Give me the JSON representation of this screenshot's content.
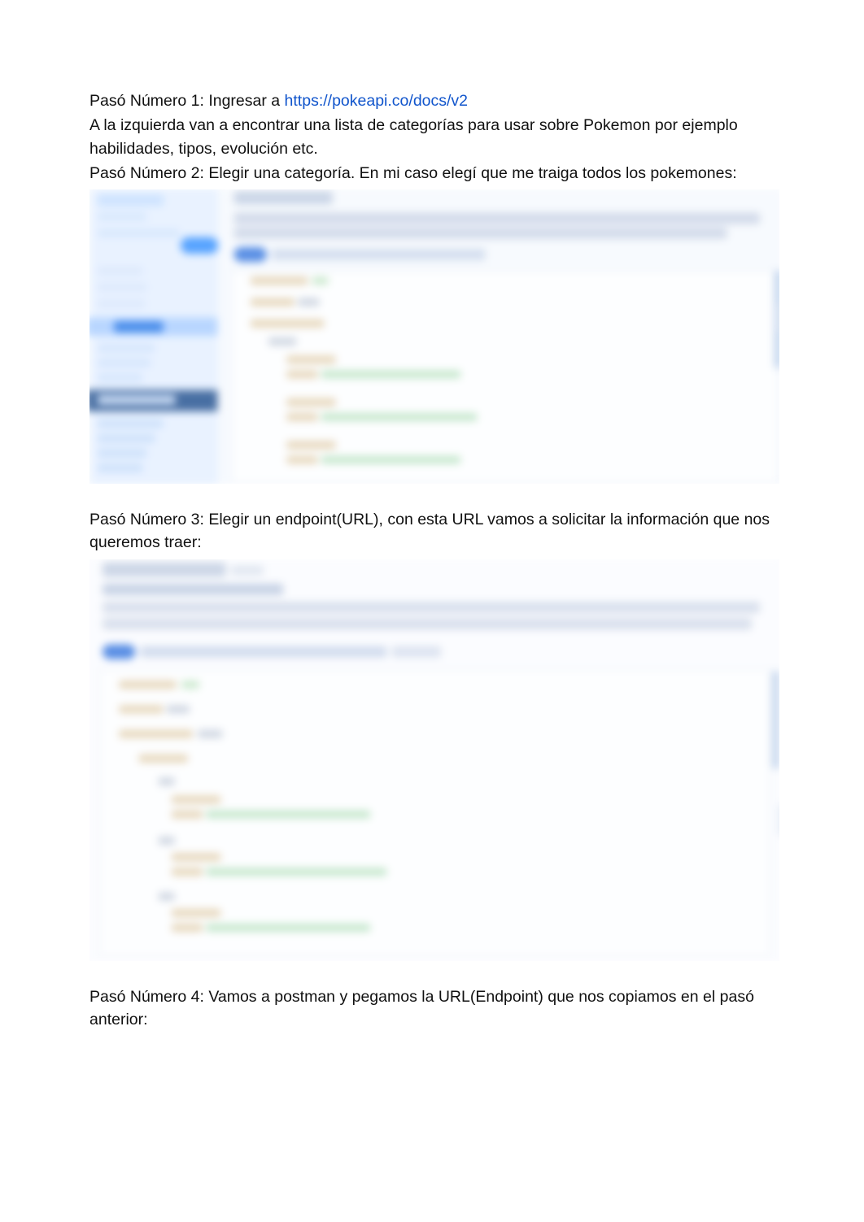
{
  "steps": {
    "s1_prefix": "Pasó Número 1: Ingresar a ",
    "s1_link_text": "https://pokeapi.co/docs/v2",
    "s1_link_href": "https://pokeapi.co/docs/v2",
    "s1_desc": "A la izquierda van a encontrar una lista de categorías para usar sobre Pokemon por ejemplo habilidades, tipos, evolución etc.",
    "s2": "Pasó Número 2: Elegir una categoría. En mi caso elegí que me traiga todos los pokemones:",
    "s3": "Pasó Número 3: Elegir un endpoint(URL), con esta URL vamos a solicitar la información que nos queremos traer:",
    "s4": "Pasó Número 4: Vamos a postman y pegamos la URL(Endpoint) que nos copiamos en el pasó anterior:"
  }
}
